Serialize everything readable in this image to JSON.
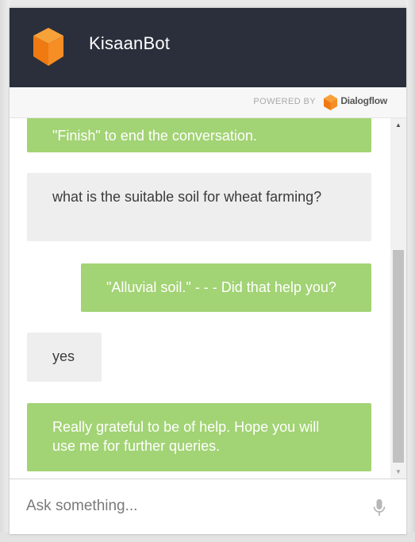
{
  "header": {
    "bot_name": "KisaanBot"
  },
  "powered_by": {
    "label": "POWERED BY",
    "brand": "Dialogflow"
  },
  "messages": [
    {
      "from": "bot",
      "text": "\"Finish\" to end the conversation."
    },
    {
      "from": "user",
      "text": "what is the suitable soil for wheat farming?"
    },
    {
      "from": "bot",
      "text": "\"Alluvial soil.\" - - - Did that help you?"
    },
    {
      "from": "user",
      "text": "yes"
    },
    {
      "from": "bot",
      "text": "Really grateful to be of help. Hope you will use me for further queries."
    }
  ],
  "input": {
    "placeholder": "Ask something..."
  },
  "colors": {
    "header_bg": "#2a2f3b",
    "bot_bubble": "#a2d374",
    "user_bubble": "#eeeeee",
    "logo_orange": "#f48a1f"
  },
  "icons": [
    "bot-cube-icon",
    "dialogflow-logo-icon",
    "scroll-up-arrow",
    "scroll-down-arrow",
    "microphone-icon"
  ]
}
